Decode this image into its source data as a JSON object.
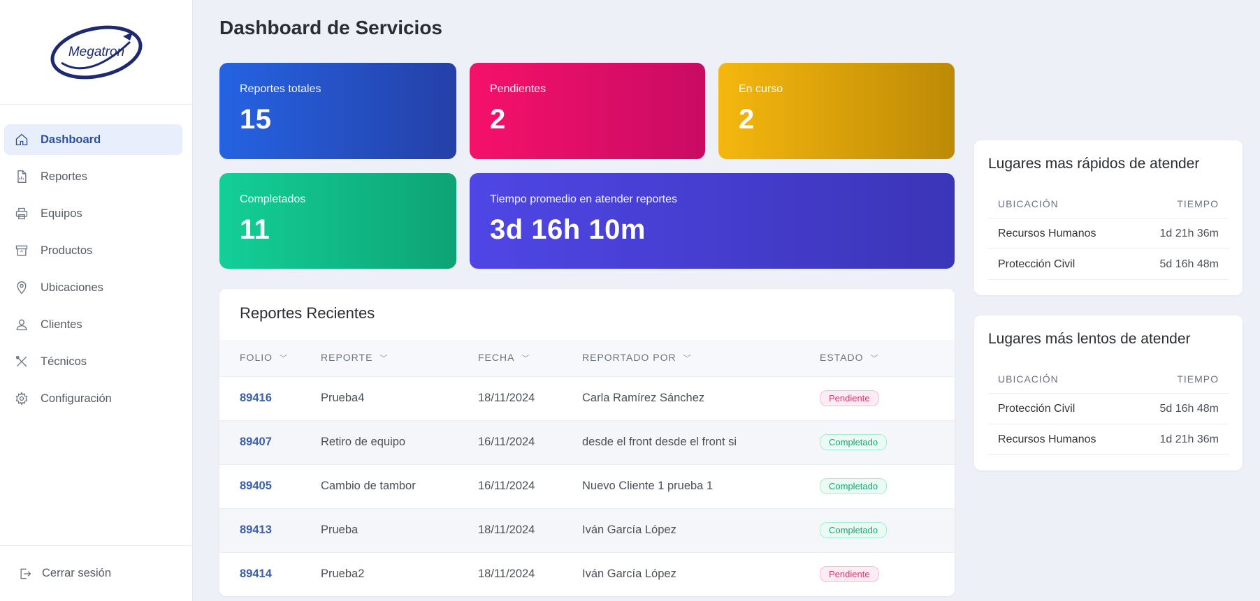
{
  "brand": {
    "logo_text": "Megatron",
    "color": "#1e2a6e"
  },
  "sidebar": {
    "items": [
      {
        "label": "Dashboard",
        "icon": "home-icon",
        "active": true
      },
      {
        "label": "Reportes",
        "icon": "document-icon",
        "active": false
      },
      {
        "label": "Equipos",
        "icon": "printer-icon",
        "active": false
      },
      {
        "label": "Productos",
        "icon": "archive-box-icon",
        "active": false
      },
      {
        "label": "Ubicaciones",
        "icon": "map-pin-icon",
        "active": false
      },
      {
        "label": "Clientes",
        "icon": "user-icon",
        "active": false
      },
      {
        "label": "Técnicos",
        "icon": "tools-icon",
        "active": false
      },
      {
        "label": "Configuración",
        "icon": "gear-icon",
        "active": false
      }
    ],
    "logout_label": "Cerrar sesión"
  },
  "page": {
    "title": "Dashboard de Servicios"
  },
  "stats": {
    "total": {
      "label": "Reportes totales",
      "value": "15",
      "color": "#2563e2"
    },
    "pending": {
      "label": "Pendientes",
      "value": "2",
      "color": "#f5116a"
    },
    "in_progress": {
      "label": "En curso",
      "value": "2",
      "color": "#f5b70e"
    },
    "completed": {
      "label": "Completados",
      "value": "11",
      "color": "#13cf97"
    },
    "avg_time": {
      "label": "Tiempo promedio en atender reportes",
      "value": "3d 16h 10m",
      "color": "#4f46e5"
    }
  },
  "recent": {
    "title": "Reportes Recientes",
    "columns": [
      "FOLIO",
      "REPORTE",
      "FECHA",
      "REPORTADO POR",
      "ESTADO"
    ],
    "rows": [
      {
        "folio": "89416",
        "reporte": "Prueba4",
        "fecha": "18/11/2024",
        "por": "Carla Ramírez Sánchez",
        "estado": "Pendiente"
      },
      {
        "folio": "89407",
        "reporte": "Retiro de equipo",
        "fecha": "16/11/2024",
        "por": "desde el front desde el front si",
        "estado": "Completado"
      },
      {
        "folio": "89405",
        "reporte": "Cambio de tambor",
        "fecha": "16/11/2024",
        "por": "Nuevo Cliente 1 prueba 1",
        "estado": "Completado"
      },
      {
        "folio": "89413",
        "reporte": "Prueba",
        "fecha": "18/11/2024",
        "por": "Iván García López",
        "estado": "Completado"
      },
      {
        "folio": "89414",
        "reporte": "Prueba2",
        "fecha": "18/11/2024",
        "por": "Iván García López",
        "estado": "Pendiente"
      }
    ]
  },
  "fastest": {
    "title": "Lugares mas rápidos de atender",
    "col_location": "UBICACIÓN",
    "col_time": "TIEMPO",
    "rows": [
      {
        "location": "Recursos Humanos",
        "time": "1d 21h 36m"
      },
      {
        "location": "Protección Civil",
        "time": "5d 16h 48m"
      }
    ]
  },
  "slowest": {
    "title": "Lugares más lentos de atender",
    "col_location": "UBICACIÓN",
    "col_time": "TIEMPO",
    "rows": [
      {
        "location": "Protección Civil",
        "time": "5d 16h 48m"
      },
      {
        "location": "Recursos Humanos",
        "time": "1d 21h 36m"
      }
    ]
  }
}
